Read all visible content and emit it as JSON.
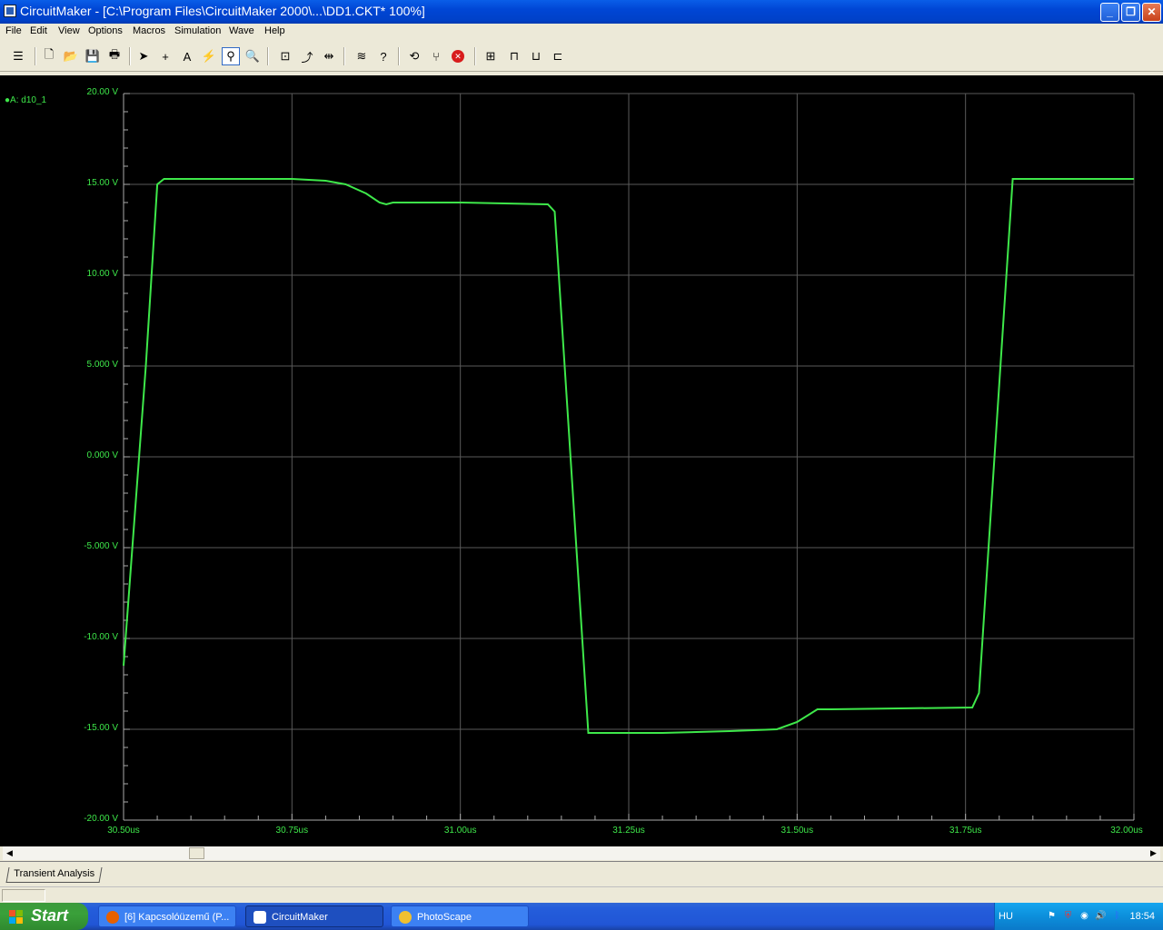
{
  "window": {
    "title": "CircuitMaker - [C:\\Program Files\\CircuitMaker 2000\\...\\DD1.CKT* 100%]",
    "minimize": "_",
    "restore": "❐",
    "close": "✕"
  },
  "menu": [
    "File",
    "Edit",
    "View",
    "Options",
    "Macros",
    "Simulation",
    "Wave",
    "Help"
  ],
  "plot": {
    "legend": "●A: d10_1",
    "trace_color": "#3ee84a",
    "y_labels": [
      "20.00 V",
      "15.00 V",
      "10.00 V",
      "5.000 V",
      "0.000 V",
      "-5.000 V",
      "-10.00 V",
      "-15.00 V",
      "-20.00 V"
    ],
    "x_labels": [
      "30.50us",
      "30.75us",
      "31.00us",
      "31.25us",
      "31.50us",
      "31.75us",
      "32.00us"
    ]
  },
  "chart_data": {
    "type": "line",
    "title": "",
    "xlabel": "",
    "ylabel": "",
    "xlim": [
      30.5,
      32.0
    ],
    "ylim": [
      -20,
      20
    ],
    "grid": true,
    "series": [
      {
        "name": "A: d10_1",
        "x": [
          30.5,
          30.533,
          30.55,
          30.56,
          30.75,
          30.8,
          30.83,
          30.86,
          30.88,
          30.89,
          30.9,
          31.0,
          31.13,
          31.14,
          31.19,
          31.2,
          31.3,
          31.4,
          31.47,
          31.5,
          31.53,
          31.55,
          31.76,
          31.77,
          31.82,
          31.83,
          32.0
        ],
        "y": [
          -11.5,
          5.0,
          15.0,
          15.3,
          15.3,
          15.2,
          15.0,
          14.5,
          14.0,
          13.9,
          14.0,
          14.0,
          13.9,
          13.5,
          -15.2,
          -15.2,
          -15.2,
          -15.1,
          -15.0,
          -14.6,
          -13.9,
          -13.9,
          -13.8,
          -13.0,
          15.3,
          15.3,
          15.3
        ]
      }
    ]
  },
  "tabs": {
    "transient": "Transient Analysis"
  },
  "taskbar": {
    "start": "Start",
    "tasks": [
      "[6] Kapcsolóüzemű (P...",
      "CircuitMaker",
      "PhotoScape"
    ],
    "lang": "HU",
    "clock": "18:54"
  }
}
